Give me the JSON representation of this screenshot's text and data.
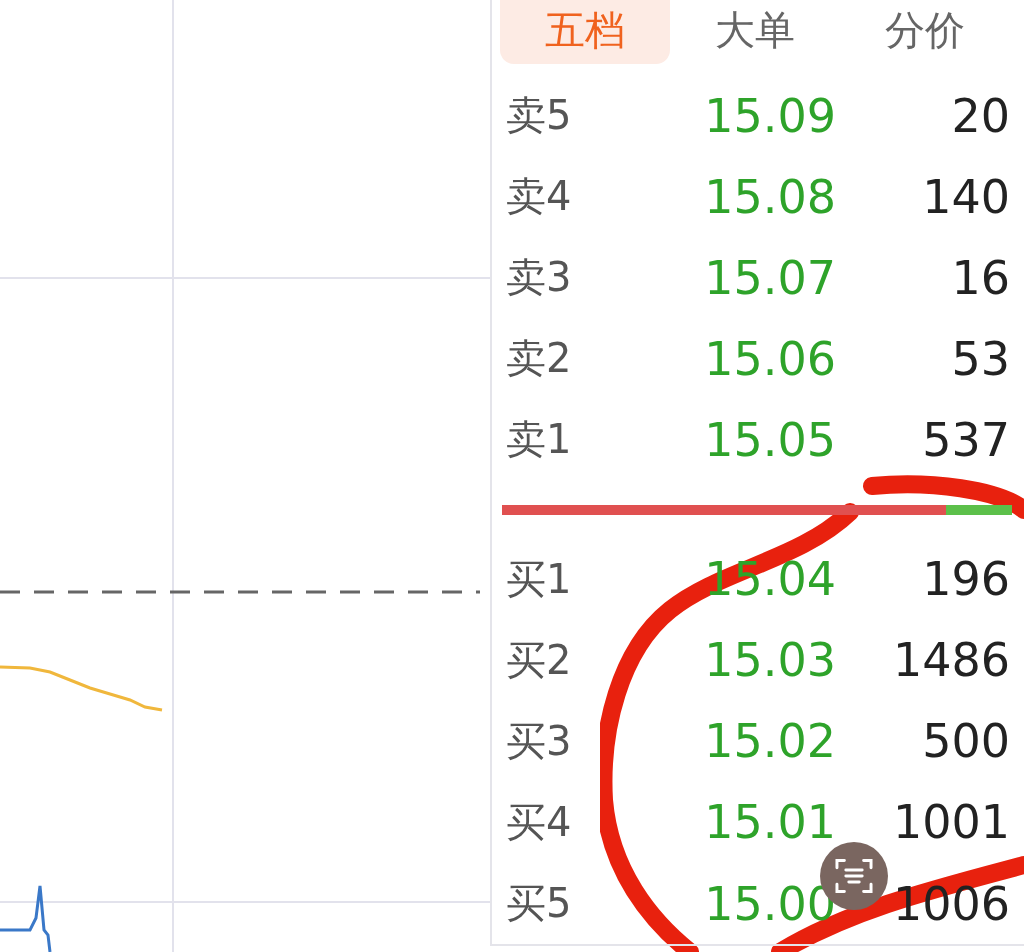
{
  "tabs": [
    {
      "label": "五档",
      "selected": true
    },
    {
      "label": "大单",
      "selected": false
    },
    {
      "label": "分价",
      "selected": false
    }
  ],
  "sell_orders": [
    {
      "label": "卖5",
      "price": "15.09",
      "volume": "20"
    },
    {
      "label": "卖4",
      "price": "15.08",
      "volume": "140"
    },
    {
      "label": "卖3",
      "price": "15.07",
      "volume": "16"
    },
    {
      "label": "卖2",
      "price": "15.06",
      "volume": "53"
    },
    {
      "label": "卖1",
      "price": "15.05",
      "volume": "537"
    }
  ],
  "ratio_bar": {
    "level": 0.87
  },
  "buy_orders": [
    {
      "label": "买1",
      "price": "15.04",
      "volume": "196"
    },
    {
      "label": "买2",
      "price": "15.03",
      "volume": "1486"
    },
    {
      "label": "买3",
      "price": "15.02",
      "volume": "500"
    },
    {
      "label": "买4",
      "price": "15.01",
      "volume": "1001"
    },
    {
      "label": "买5",
      "price": "15.00",
      "volume": "1006"
    }
  ]
}
